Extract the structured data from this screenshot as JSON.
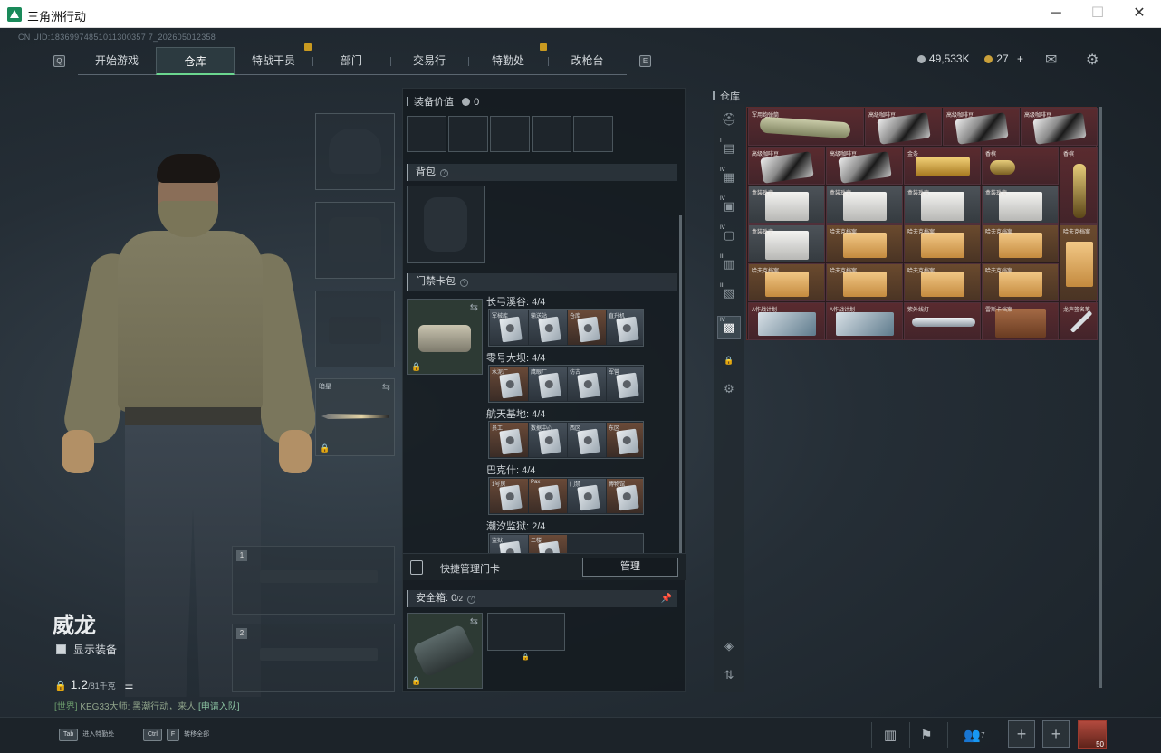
{
  "window": {
    "title": "三角洲行动",
    "minimize": "─",
    "maximize": "☐",
    "close": "✕"
  },
  "uid": "CN UID:18369974851011300357 7_202605012358",
  "nav": {
    "prev_key": "Q",
    "next_key": "E",
    "tabs": [
      "开始游戏",
      "仓库",
      "特战干员",
      "部门",
      "交易行",
      "特勤处",
      "改枪台"
    ],
    "active": "仓库"
  },
  "currency": {
    "silver": "49,533K",
    "gold": "27",
    "plus": "+"
  },
  "icons": {
    "mail": "mail-icon",
    "settings": "gear-icon"
  },
  "equipment": {
    "knife_label": "暗星",
    "weapon_slot_1": "1",
    "weapon_slot_2": "2"
  },
  "operator": {
    "name": "威龙",
    "show_equipment": "显示装备"
  },
  "weight": {
    "value": "1.2",
    "max": "/81千克"
  },
  "chat": {
    "channel": "[世界]",
    "user": "KEG33大师:",
    "message": " 黑潮行动，来人 ",
    "link": "[申请入队]"
  },
  "middle": {
    "equip_value_label": "装备价值",
    "equip_value": "0",
    "backpack_label": "背包",
    "keycard_label": "门禁卡包",
    "maps": [
      {
        "name": "长弓溪谷: 4/4",
        "cards": [
          "军械库",
          "输送站",
          "仓库",
          "直升机"
        ],
        "colors": [
          "grey",
          "grey",
          "brown",
          "grey"
        ]
      },
      {
        "name": "零号大坝: 4/4",
        "cards": [
          "水泥厂",
          "鹰眼厂",
          "仿古",
          "军营"
        ],
        "colors": [
          "brown",
          "grey",
          "grey",
          "grey"
        ]
      },
      {
        "name": "航天基地: 4/4",
        "cards": [
          "员工",
          "数据中心",
          "西区",
          "东区"
        ],
        "colors": [
          "brown",
          "grey",
          "grey",
          "brown"
        ]
      },
      {
        "name": "巴克什: 4/4",
        "cards": [
          "1号房",
          "Pax",
          "门禁",
          "博物馆"
        ],
        "colors": [
          "brown",
          "brown",
          "grey",
          "brown"
        ]
      },
      {
        "name": "潮汐监狱: 2/4",
        "cards": [
          "监狱",
          "二楼"
        ],
        "colors": [
          "grey",
          "brown"
        ]
      }
    ],
    "quick_manage_label": "快捷管理门卡",
    "manage_button": "管理",
    "safebox_label": "安全箱:",
    "safebox_count": "0",
    "safebox_max": "/2"
  },
  "stash": {
    "label": "仓库",
    "items": [
      {
        "name": "军用炮弹筒",
        "color": "red",
        "shape": "tube"
      },
      {
        "name": "高级咖啡豆",
        "color": "red",
        "shape": "coffee"
      },
      {
        "name": "高级咖啡豆",
        "color": "red",
        "shape": "coffee"
      },
      {
        "name": "高级咖啡豆",
        "color": "red",
        "shape": "coffee"
      },
      {
        "name": "高级咖啡豆",
        "color": "red",
        "shape": "coffee"
      },
      {
        "name": "高级咖啡豆",
        "color": "red",
        "shape": "coffee"
      },
      {
        "name": "金条",
        "color": "red",
        "shape": "gold"
      },
      {
        "name": "香槟",
        "color": "red",
        "shape": "bottle"
      },
      {
        "name": "香槟",
        "color": "red",
        "shape": "bottle"
      },
      {
        "name": "盒装珠宝",
        "color": "grey",
        "shape": "box"
      },
      {
        "name": "盒装珠宝",
        "color": "grey",
        "shape": "box"
      },
      {
        "name": "盒装珠宝",
        "color": "grey",
        "shape": "box"
      },
      {
        "name": "盒装珠宝",
        "color": "grey",
        "shape": "box"
      },
      {
        "name": "盒装珠宝",
        "color": "grey",
        "shape": "box"
      },
      {
        "name": "哈夫克档案",
        "color": "orange",
        "shape": "folder"
      },
      {
        "name": "哈夫克档案",
        "color": "orange",
        "shape": "folder"
      },
      {
        "name": "哈夫克档案",
        "color": "orange",
        "shape": "folder"
      },
      {
        "name": "哈夫克档案",
        "color": "orange",
        "shape": "folder"
      },
      {
        "name": "哈夫克档案",
        "color": "orange",
        "shape": "folder"
      },
      {
        "name": "哈夫克档案",
        "color": "orange",
        "shape": "folder"
      },
      {
        "name": "哈夫克档案",
        "color": "orange",
        "shape": "folder"
      },
      {
        "name": "哈夫克档案",
        "color": "orange",
        "shape": "folder"
      },
      {
        "name": "A作战计划",
        "color": "red",
        "shape": "plan"
      },
      {
        "name": "A作战计划",
        "color": "red",
        "shape": "plan"
      },
      {
        "name": "紫外线灯",
        "color": "red",
        "shape": "lamp"
      },
      {
        "name": "雷斯卡档案",
        "color": "red",
        "shape": "leather"
      },
      {
        "name": "龙声签名笔",
        "color": "red",
        "shape": "pen"
      }
    ]
  },
  "footer": {
    "tab_key": "Tab",
    "tab_label": "进入特勤处",
    "ctrl_key": "Ctrl",
    "f_key": "F",
    "ctrl_label": "转移全部",
    "friends_count": "7",
    "plus": "+",
    "avatar_number": "50"
  }
}
